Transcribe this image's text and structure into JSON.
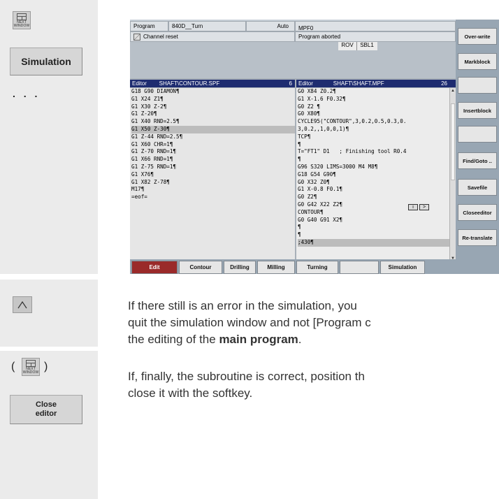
{
  "left_panel": {
    "next_window_label": "NEXT WINDOW",
    "simulation_button": "Simulation",
    "ellipsis": ". . .",
    "caret_key": "^",
    "paren_open": "(",
    "paren_close": ")",
    "close_editor_line1": "Close",
    "close_editor_line2": "editor"
  },
  "paragraphs": {
    "p1_line1": "If there still is an error in the simulation, you",
    "p1_line2": "quit the simulation window and not [Program c",
    "p1_line3_prefix": "the editing of the ",
    "p1_line3_bold": "main program",
    "p1_line3_suffix": ".",
    "p2_line1": "If, finally, the subroutine is correct, position th",
    "p2_line2": "close it with the softkey."
  },
  "hmi": {
    "header": {
      "program_label": "Program",
      "program_value": "840D__Turn",
      "mode": "Auto",
      "file": "MPF0",
      "channel_status": "Channel reset",
      "program_status": "Program aborted",
      "rov": "ROV",
      "sbl": "SBL1"
    },
    "left_editor": {
      "title": "Editor        SHAFT\\CONTOUR.SPF",
      "number": "6",
      "lines": [
        "G18 G90 DIAMON¶",
        "G1 X24 Z1¶",
        "G1 X30 Z-2¶",
        "G1 Z-20¶",
        "G1 X40 RND=2.5¶",
        "G1 X50 Z-30¶",
        "G1 Z-44 RND=2.5¶",
        "G1 X60 CHR=1¶",
        "G1 Z-70 RND=1¶",
        "G1 X66 RND=1¶",
        "G1 Z-75 RND=1¶",
        "G1 X76¶",
        "G1 X82 Z-78¶",
        "M17¶",
        "=eof="
      ]
    },
    "right_editor": {
      "title": "Editor             SHAFT\\SHAFT.MPF",
      "number": "26",
      "lines": [
        "G0 X84 Z0.2¶",
        "G1 X-1.6 F0.32¶",
        "G0 Z2 ¶",
        "G0 X80¶",
        "CYCLE95(\"CONTOUR\",3,0.2,0.5,0.3,0.",
        "3,0.2,,1,0,0,1)¶",
        "TCP¶",
        "¶",
        "T=\"FT1\" D1   ; Finishing tool R0.4",
        "¶",
        "G96 S320 LIMS=3000 M4 M8¶",
        "G18 G54 G90¶",
        "G0 X32 Z0¶",
        "G1 X-0.8 F0.1¶",
        "G0 Z2¶",
        "G0 G42 X22 Z2¶",
        "CONTOUR¶",
        "G0 G40 G91 X2¶",
        "¶",
        "¶",
        ";430¶"
      ]
    },
    "info_icons": [
      "i",
      ">"
    ],
    "right_softkeys": [
      {
        "l1": "Over-",
        "l2": "write"
      },
      {
        "l1": "Mark",
        "l2": "block"
      },
      {
        "l1": "",
        "l2": ""
      },
      {
        "l1": "Insert",
        "l2": "block"
      },
      {
        "l1": "",
        "l2": ""
      },
      {
        "l1": "Find/",
        "l2": "Goto .."
      },
      {
        "l1": "Save",
        "l2": "file"
      },
      {
        "l1": "Close",
        "l2": "editor"
      },
      {
        "l1": "Re-",
        "l2": "translate"
      }
    ],
    "bottom_softkeys": [
      "Edit",
      "Contour",
      "Drilling",
      "Milling",
      "Turning",
      "",
      "Simulation"
    ]
  }
}
